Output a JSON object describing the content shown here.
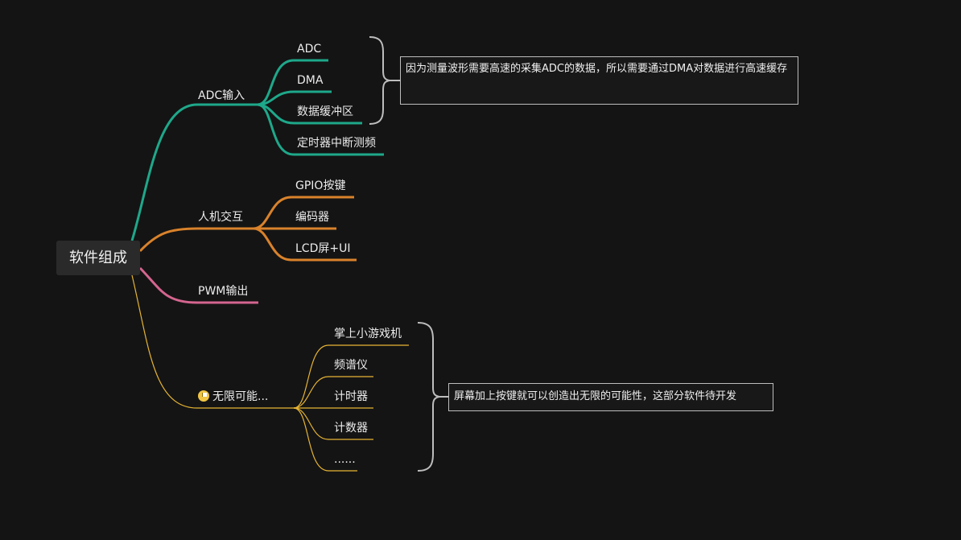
{
  "root": {
    "label": "软件组成"
  },
  "branches": {
    "adc": {
      "label": "ADC输入",
      "color": "#1ea88a",
      "children": [
        "ADC",
        "DMA",
        "数据缓冲区",
        "定时器中断测频"
      ]
    },
    "hmi": {
      "label": "人机交互",
      "color": "#d9822b",
      "children": [
        "GPIO按键",
        "编码器",
        "LCD屏+UI"
      ]
    },
    "pwm": {
      "label": "PWM输出",
      "color": "#d4658f",
      "children": []
    },
    "more": {
      "label": "无限可能...",
      "color": "#e6b434",
      "icon": "flag-icon",
      "children": [
        "掌上小游戏机",
        "频谱仪",
        "计时器",
        "计数器",
        "......"
      ]
    }
  },
  "notes": {
    "adc_note": "因为测量波形需要高速的采集ADC的数据，所以需要通过DMA对数据进行高速缓存",
    "more_note": "屏幕加上按键就可以创造出无限的可能性，这部分软件待开发"
  },
  "colors": {
    "background": "#141414",
    "bracket": "#bdbdbd"
  }
}
